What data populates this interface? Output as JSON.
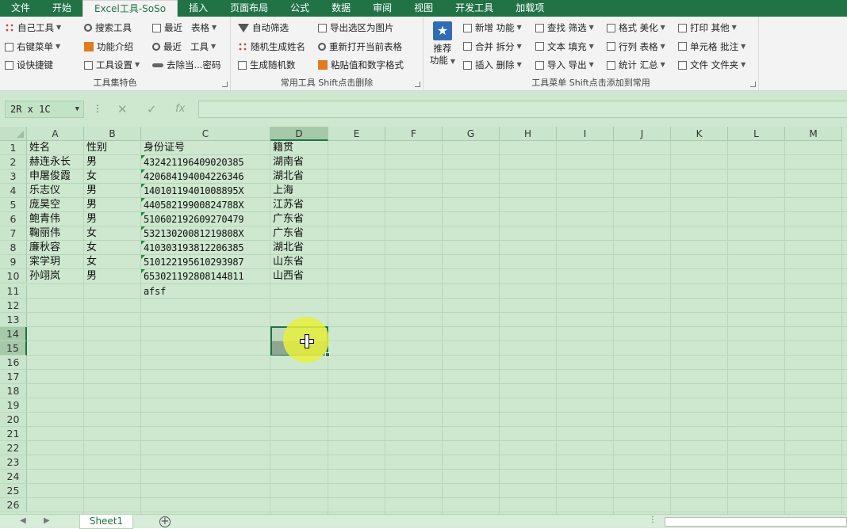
{
  "menu": {
    "tabs": [
      "文件",
      "开始",
      "Excel工具-SoSo",
      "插入",
      "页面布局",
      "公式",
      "数据",
      "审阅",
      "视图",
      "开发工具",
      "加载项"
    ],
    "active": 2
  },
  "ribbon": {
    "g1": {
      "label": "工具集特色",
      "items": [
        "自己工具",
        "右键菜单",
        "设快捷键",
        "搜索工具",
        "功能介绍",
        "工具设置",
        "最近",
        "表格",
        "最近",
        "工具",
        "去除当...密码"
      ]
    },
    "g2": {
      "label": "常用工具 Shift点击删除",
      "items": [
        "自动筛选",
        "随机生成姓名",
        "生成随机数",
        "导出选区为图片",
        "重新打开当前表格",
        "粘贴值和数字格式"
      ]
    },
    "g3": {
      "label": "工具菜单 Shift点击添加到常用",
      "big": [
        "推荐",
        "功能"
      ],
      "items": [
        "新增",
        "功能",
        "合并",
        "拆分",
        "插入",
        "删除",
        "查找",
        "筛选",
        "文本",
        "填充",
        "导入",
        "导出",
        "格式",
        "美化",
        "行列",
        "表格",
        "统计",
        "汇总",
        "打印",
        "其他",
        "单元格",
        "批注",
        "文件",
        "文件夹"
      ]
    }
  },
  "formula": {
    "namebox": "2R x 1C",
    "fx": "fx",
    "value": ""
  },
  "columns": [
    "A",
    "B",
    "C",
    "D",
    "E",
    "F",
    "G",
    "H",
    "I",
    "J",
    "K",
    "L",
    "M"
  ],
  "rows": [
    "1",
    "2",
    "3",
    "4",
    "5",
    "6",
    "7",
    "8",
    "9",
    "10",
    "11",
    "12",
    "13",
    "14",
    "15",
    "16",
    "17",
    "18",
    "19",
    "20",
    "21",
    "22",
    "23",
    "24",
    "25",
    "26"
  ],
  "cells": {
    "headers": [
      "姓名",
      "性别",
      "身份证号",
      "籍贯"
    ],
    "data": [
      [
        "赫连永长",
        "男",
        "432421196409020385",
        "湖南省"
      ],
      [
        "申屠俊霞",
        "女",
        "420684194004226346",
        "湖北省"
      ],
      [
        "乐志仪",
        "男",
        "14010119401008895X",
        "上海"
      ],
      [
        "庞昊空",
        "男",
        "44058219900824788X",
        "江苏省"
      ],
      [
        "鲍青伟",
        "男",
        "510602192609270479",
        "广东省"
      ],
      [
        "鞠丽伟",
        "女",
        "53213020081219808X",
        "广东省"
      ],
      [
        "廉秋容",
        "女",
        "410303193812206385",
        "湖北省"
      ],
      [
        "寀学玥",
        "女",
        "510122195610293987",
        "山东省"
      ],
      [
        "孙翊岚",
        "男",
        "653021192808144811",
        "山西省"
      ]
    ],
    "c11": "afsf"
  },
  "sheets": {
    "active": "Sheet1"
  }
}
